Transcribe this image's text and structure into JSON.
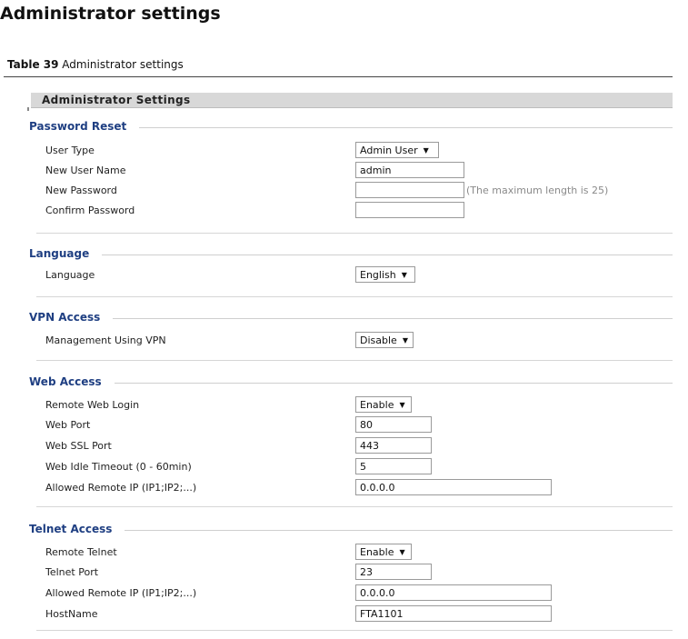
{
  "document": {
    "title": "Administrator settings",
    "caption_label": "Table 39",
    "caption_text": "Administrator settings"
  },
  "panel": {
    "header": "Administrator Settings"
  },
  "sections": {
    "password_reset": {
      "title": "Password Reset",
      "user_type": {
        "label": "User Type",
        "value": "Admin User"
      },
      "new_user_name": {
        "label": "New User Name",
        "value": "admin"
      },
      "new_password": {
        "label": "New Password",
        "value": "",
        "hint": "(The maximum length is 25)"
      },
      "confirm_password": {
        "label": "Confirm Password",
        "value": ""
      }
    },
    "language": {
      "title": "Language",
      "language": {
        "label": "Language",
        "value": "English"
      }
    },
    "vpn_access": {
      "title": "VPN Access",
      "management_vpn": {
        "label": "Management Using VPN",
        "value": "Disable"
      }
    },
    "web_access": {
      "title": "Web Access",
      "remote_web_login": {
        "label": "Remote Web Login",
        "value": "Enable"
      },
      "web_port": {
        "label": "Web Port",
        "value": "80"
      },
      "web_ssl_port": {
        "label": "Web SSL Port",
        "value": "443"
      },
      "web_idle_timeout": {
        "label": "Web Idle Timeout (0 - 60min)",
        "value": "5"
      },
      "allowed_remote_ip": {
        "label": "Allowed Remote IP (IP1;IP2;...)",
        "value": "0.0.0.0"
      }
    },
    "telnet_access": {
      "title": "Telnet Access",
      "remote_telnet": {
        "label": "Remote Telnet",
        "value": "Enable"
      },
      "telnet_port": {
        "label": "Telnet Port",
        "value": "23"
      },
      "allowed_remote_ip": {
        "label": "Allowed Remote IP (IP1;IP2;...)",
        "value": "0.0.0.0"
      },
      "hostname": {
        "label": "HostName",
        "value": "FTA1101"
      }
    }
  },
  "icons": {
    "dropdown_arrow": "▼"
  }
}
